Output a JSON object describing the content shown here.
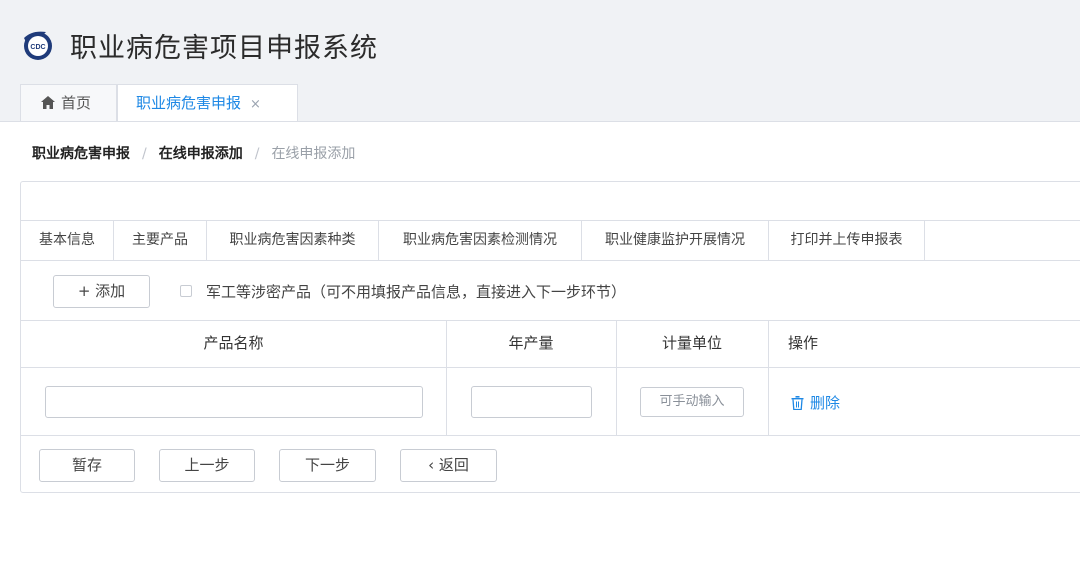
{
  "app": {
    "title": "职业病危害项目申报系统",
    "logo_text": "CDC"
  },
  "tabs": [
    {
      "label": "首页",
      "icon": "home-icon"
    },
    {
      "label": "职业病危害申报",
      "close_icon": "×"
    }
  ],
  "breadcrumb": [
    "职业病危害申报",
    "在线申报添加",
    "在线申报添加"
  ],
  "breadcrumb_separator": "/",
  "steps": [
    "基本信息",
    "主要产品",
    "职业病危害因素种类",
    "职业病危害因素检测情况",
    "职业健康监护开展情况",
    "打印并上传申报表"
  ],
  "toolbar": {
    "add_label": "+ 添加",
    "checkbox_label": "军工等涉密产品（可不用填报产品信息，直接进入下一步环节）"
  },
  "table": {
    "columns": [
      "产品名称",
      "年产量",
      "计量单位",
      "操作"
    ],
    "rows": [
      {
        "product_name": "",
        "annual_output": "",
        "unit_placeholder": "可手动输入",
        "action": "删除"
      }
    ]
  },
  "footer": {
    "save_label": "暂存",
    "prev_label": "上一步",
    "next_label": "下一步",
    "back_label": "‹ 返回"
  },
  "colors": {
    "accent": "#1e88e5",
    "header_bg": "#f0f2f5",
    "border": "#dcdfe6"
  }
}
